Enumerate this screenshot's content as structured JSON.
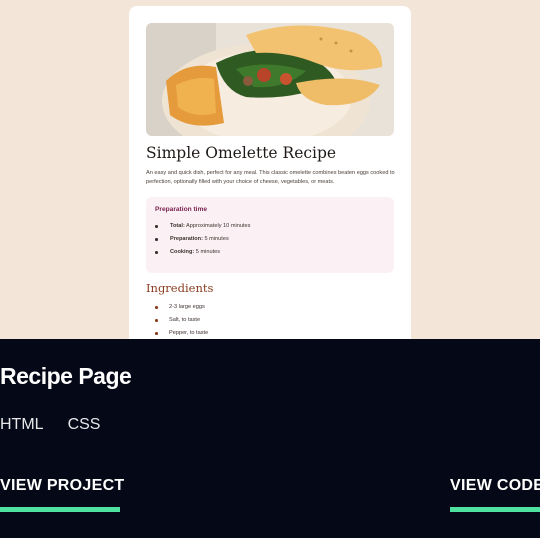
{
  "preview": {
    "title": "Simple Omelette Recipe",
    "description": "An easy and quick dish, perfect for any meal. This classic omelette combines beaten eggs cooked to perfection, optionally filled with your choice of cheese, vegetables, or meats.",
    "preparation": {
      "heading": "Preparation time",
      "items": [
        {
          "label": "Total:",
          "value": " Approximately 10 minutes"
        },
        {
          "label": "Preparation:",
          "value": " 5 minutes"
        },
        {
          "label": "Cooking:",
          "value": " 5 minutes"
        }
      ]
    },
    "ingredients": {
      "heading": "Ingredients",
      "items": [
        "2-3 large eggs",
        "Salt, to taste",
        "Pepper, to taste"
      ]
    }
  },
  "project": {
    "title": "Recipe Page",
    "tech": [
      "HTML",
      "CSS"
    ],
    "view_project_label": "VIEW PROJECT",
    "view_code_label": "VIEW CODE"
  },
  "colors": {
    "page_background": "#050816",
    "preview_background": "#f3e5d8",
    "accent_underline": "#4ee1a0",
    "prep_heading": "#7a2350",
    "ingredients_heading": "#8a3c1e"
  }
}
